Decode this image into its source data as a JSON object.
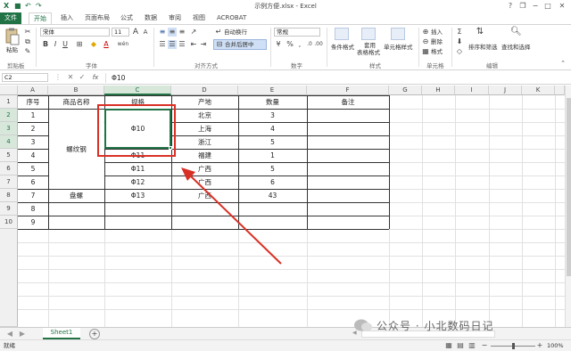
{
  "window": {
    "title": "示例方便.xlsx - Excel"
  },
  "quick_access": {
    "save_icon": "save-icon",
    "undo_icon": "undo-icon",
    "redo_icon": "redo-icon"
  },
  "window_controls": {
    "help": "?",
    "restore": "❐",
    "minimize": "−",
    "maximize": "□",
    "close": "✕"
  },
  "ribbon_tabs": [
    "文件",
    "开始",
    "插入",
    "页面布局",
    "公式",
    "数据",
    "审阅",
    "视图",
    "ACROBAT"
  ],
  "ribbon": {
    "clipboard": {
      "paste_label": "粘贴",
      "group_label": "剪贴板"
    },
    "font": {
      "font_name": "宋体",
      "font_size": "11",
      "bold": "B",
      "italic": "I",
      "underline": "U",
      "group_label": "字体",
      "grow": "A",
      "shrink": "A",
      "wen": "wén",
      "font_color": "A"
    },
    "alignment": {
      "wrap_label": "自动换行",
      "merge_label": "合并后居中",
      "group_label": "对齐方式"
    },
    "number": {
      "format": "常规",
      "currency": "¥",
      "percent": "%",
      "comma": ",",
      "group_label": "数字"
    },
    "styles": {
      "conditional_label": "条件格式",
      "table_label_1": "套用",
      "table_label_2": "表格格式",
      "cell_styles_label": "单元格样式",
      "group_label": "样式"
    },
    "cells": {
      "insert_label": "插入",
      "delete_label": "删除",
      "format_label": "格式",
      "group_label": "单元格"
    },
    "editing": {
      "sort_label": "排序和筛选",
      "find_label": "查找和选择",
      "group_label": "编辑"
    }
  },
  "formula_bar": {
    "name_box": "C2",
    "x": "✕",
    "check": "✓",
    "fx": "fx",
    "formula": "Φ10"
  },
  "columns": [
    "A",
    "B",
    "C",
    "D",
    "E",
    "F",
    "G",
    "H",
    "I",
    "J",
    "K"
  ],
  "rows": [
    "1",
    "2",
    "3",
    "4",
    "5",
    "6",
    "7",
    "8",
    "9",
    "10"
  ],
  "table": {
    "headers": {
      "seq": "序号",
      "name": "商品名称",
      "spec": "规格",
      "origin": "产地",
      "qty": "数量",
      "note": "备注"
    },
    "seq": [
      "1",
      "2",
      "3",
      "4",
      "5",
      "6",
      "7",
      "8",
      "9"
    ],
    "name_merged_1": "螺纹钢",
    "name_r7": "盘螺",
    "spec_merged": "Φ10",
    "spec": [
      "Φ11",
      "Φ11",
      "Φ12",
      "Φ13"
    ],
    "origin": [
      "北京",
      "上海",
      "浙江",
      "福建",
      "广西",
      "广西",
      "广西"
    ],
    "qty": [
      "3",
      "4",
      "5",
      "1",
      "5",
      "6",
      "43"
    ]
  },
  "sheet_tabs": {
    "active": "Sheet1",
    "add": "+"
  },
  "status": {
    "ready": "就绪",
    "zoom": "100%"
  },
  "watermark": "公众号 · 小北数码日记",
  "colors": {
    "excel_green": "#217346",
    "annotation_red": "#d93025"
  }
}
